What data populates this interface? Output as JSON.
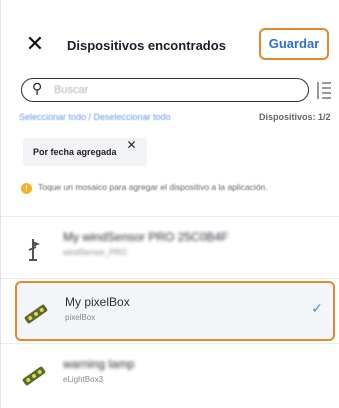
{
  "header": {
    "close_label": "✕",
    "title": "Dispositivos encontrados",
    "save_label": "Guardar"
  },
  "search": {
    "placeholder": "Buscar"
  },
  "selection": {
    "links_text": "Seleccionar todo / Deseleccionar todo",
    "device_count": "Dispositivos: 1/2"
  },
  "filter_chip": {
    "label": "Por fecha agregada",
    "remove_label": "✕"
  },
  "hint": {
    "text": "Toque un mosaico para agregar el dispositivo a la aplicación."
  },
  "devices": [
    {
      "name": "My windSensor PRO 25C0B4F",
      "type": "windSensor_PRO",
      "icon": "wind-sensor-icon",
      "selected": false
    },
    {
      "name": "My pixelBox",
      "type": "pixelBox",
      "icon": "led-strip-icon",
      "selected": true
    },
    {
      "name": "warning lamp",
      "type": "eLightBox3",
      "icon": "led-strip-icon",
      "selected": false
    }
  ],
  "colors": {
    "accent": "#e08a2e",
    "primary_blue": "#2d6fd0",
    "check_blue": "#4a8fe0",
    "hint_yellow": "#f0b323"
  }
}
